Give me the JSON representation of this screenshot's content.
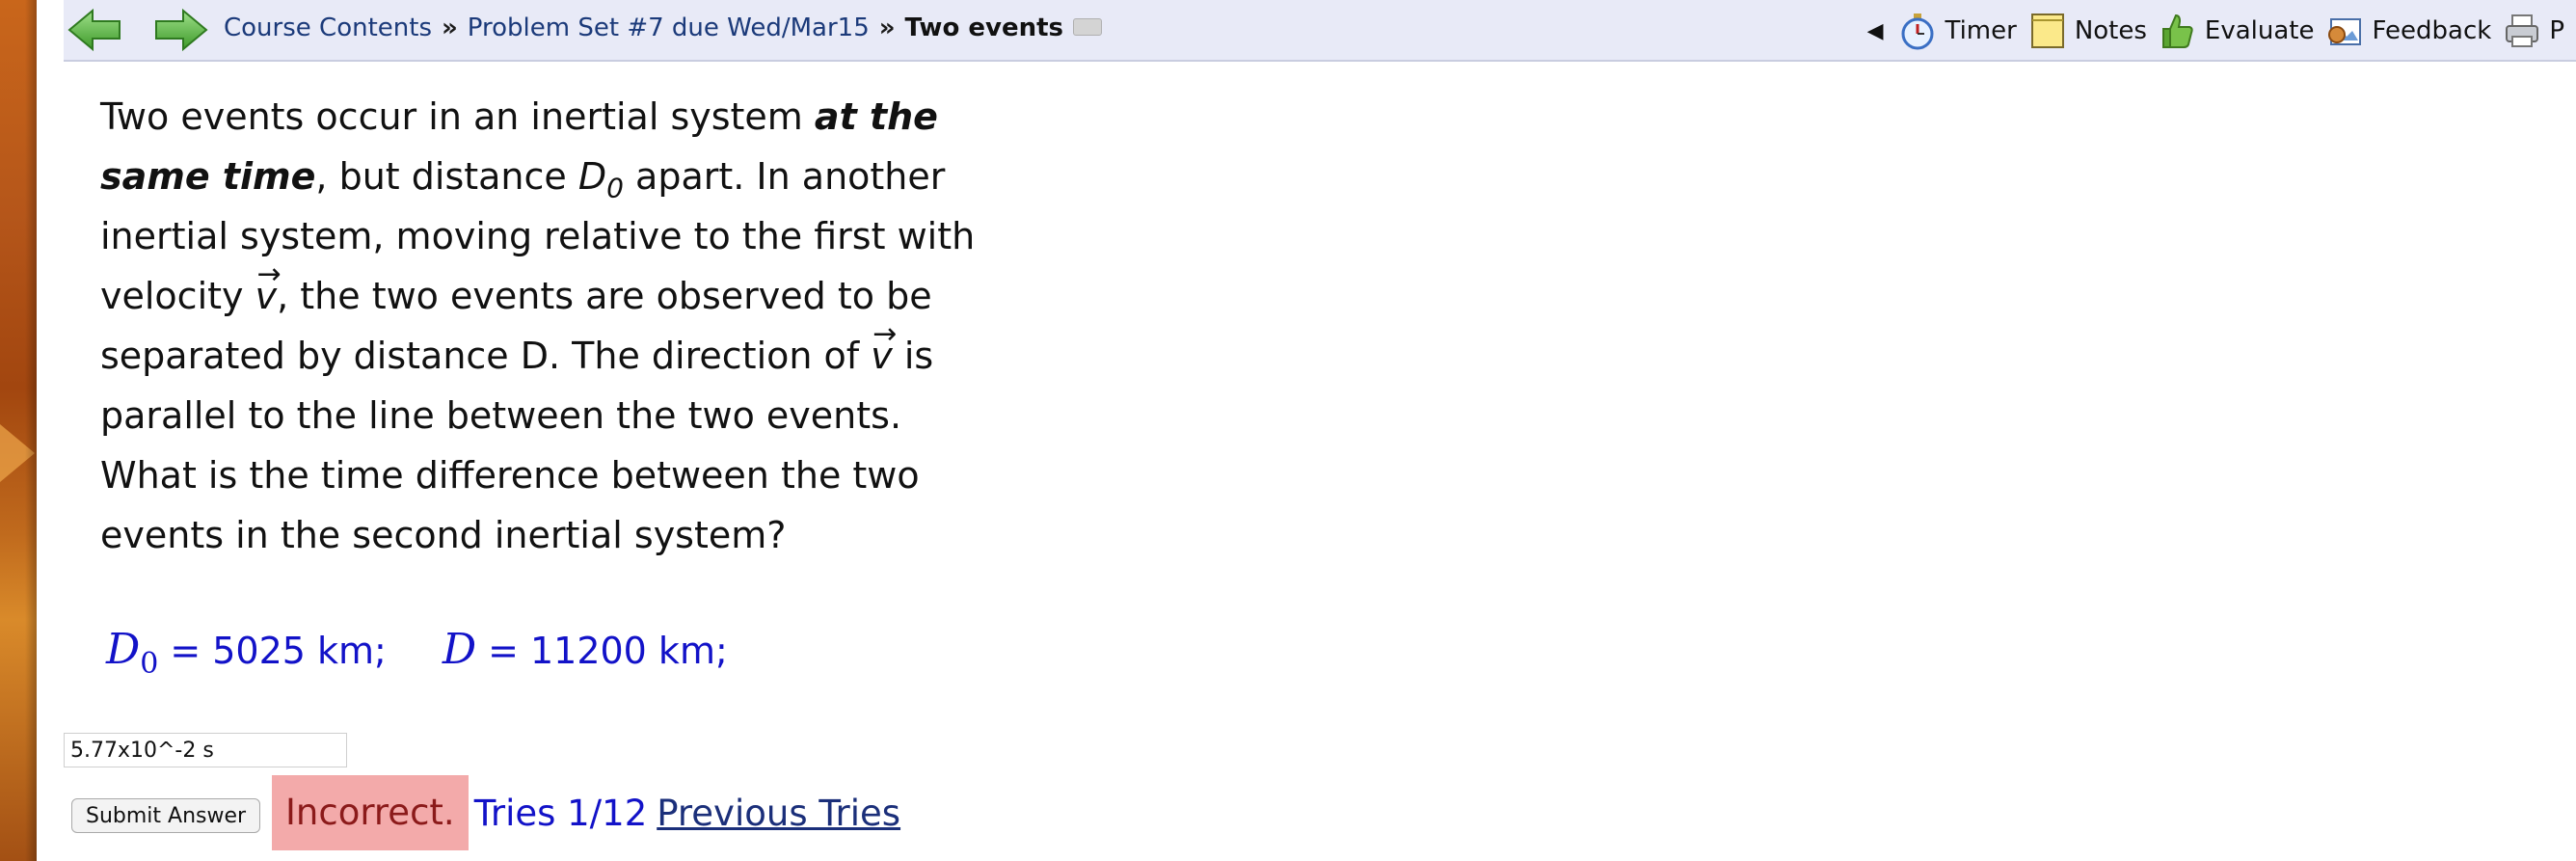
{
  "nav": {
    "breadcrumb": {
      "course": "Course Contents",
      "set": "Problem Set #7 due Wed/Mar15",
      "current": "Two events",
      "separator": "»"
    },
    "collapse_glyph": "◀",
    "tools": {
      "timer": "Timer",
      "notes": "Notes",
      "evaluate": "Evaluate",
      "feedback": "Feedback",
      "print": "P"
    }
  },
  "problem": {
    "p1": "Two events occur in an inertial system ",
    "p1_emph": "at the same time",
    "p2": ", but distance ",
    "d0_var": "D",
    "d0_sub": "0",
    "p3": " apart. In another inertial system, moving relative to the first with velocity ",
    "v_var": "v",
    "p4": ", the two events are observed to be separated by distance D. The direction of ",
    "v_var2": "v",
    "p5": " is parallel to the line between the two events.",
    "question": "What is the time difference between the two events in the second inertial system?"
  },
  "given": {
    "d0_var": "D",
    "d0_sub": "0",
    "eq": "=",
    "d0_value": "5025 km;",
    "d_var": "D",
    "d_value": "11200 km;"
  },
  "answer": {
    "value": "5.77x10^-2 s"
  },
  "submit_label": "Submit Answer",
  "status": {
    "result": "Incorrect.",
    "tries": "Tries 1/12",
    "previous_tries": "Previous Tries"
  },
  "colors": {
    "incorrect_bg": "#f3aaaa",
    "incorrect_text": "#8b1a1a",
    "given_text": "#1212c8",
    "link_text": "#1b2f7a",
    "topbar_bg": "#e8eaf7"
  }
}
